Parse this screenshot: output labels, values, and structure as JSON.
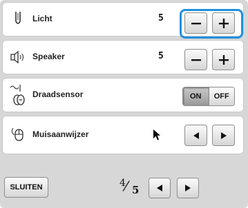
{
  "rows": {
    "light": {
      "label": "Licht",
      "value": "5"
    },
    "speaker": {
      "label": "Speaker",
      "value": "5"
    },
    "sensor": {
      "label": "Draadsensor",
      "on": "ON",
      "off": "OFF"
    },
    "pointer": {
      "label": "Muisaanwijzer"
    }
  },
  "footer": {
    "close_label": "SLUITEN",
    "page_current": "4",
    "page_total": "5"
  },
  "colors": {
    "panel_bg": "#d7d7d7",
    "highlight": "#1f90e0"
  },
  "icons": {
    "light": "needle-icon",
    "speaker": "speaker-icon",
    "sensor": "thread-sensor-icon",
    "pointer": "mouse-pointer-icon",
    "arrow_cursor": "arrow-cursor-icon"
  }
}
